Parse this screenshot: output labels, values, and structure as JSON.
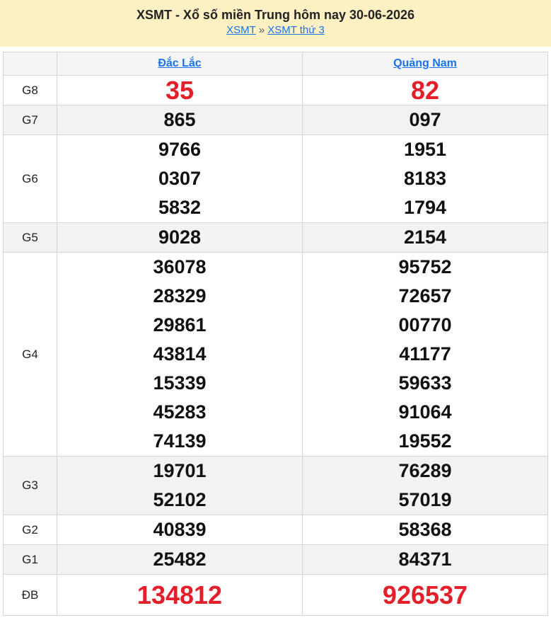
{
  "header": {
    "title": "XSMT - Xổ số miền Trung hôm nay 30-06-2026",
    "crumb1": "XSMT",
    "separator": "»",
    "crumb2": "XSMT thứ 3"
  },
  "columns": [
    "Đắc Lắc",
    "Quảng Nam"
  ],
  "prizes": {
    "g8": {
      "label": "G8",
      "c1": [
        "35"
      ],
      "c2": [
        "82"
      ]
    },
    "g7": {
      "label": "G7",
      "c1": [
        "865"
      ],
      "c2": [
        "097"
      ]
    },
    "g6": {
      "label": "G6",
      "c1": [
        "9766",
        "0307",
        "5832"
      ],
      "c2": [
        "1951",
        "8183",
        "1794"
      ]
    },
    "g5": {
      "label": "G5",
      "c1": [
        "9028"
      ],
      "c2": [
        "2154"
      ]
    },
    "g4": {
      "label": "G4",
      "c1": [
        "36078",
        "28329",
        "29861",
        "43814",
        "15339",
        "45283",
        "74139"
      ],
      "c2": [
        "95752",
        "72657",
        "00770",
        "41177",
        "59633",
        "91064",
        "19552"
      ]
    },
    "g3": {
      "label": "G3",
      "c1": [
        "19701",
        "52102"
      ],
      "c2": [
        "76289",
        "57019"
      ]
    },
    "g2": {
      "label": "G2",
      "c1": [
        "40839"
      ],
      "c2": [
        "58368"
      ]
    },
    "g1": {
      "label": "G1",
      "c1": [
        "25482"
      ],
      "c2": [
        "84371"
      ]
    },
    "db": {
      "label": "ĐB",
      "c1": [
        "134812"
      ],
      "c2": [
        "926537"
      ]
    }
  },
  "colors": {
    "header_bg": "#fdf1c4",
    "link": "#1a73e8",
    "highlight": "#e3202a",
    "alt_row": "#f2f2f2"
  }
}
